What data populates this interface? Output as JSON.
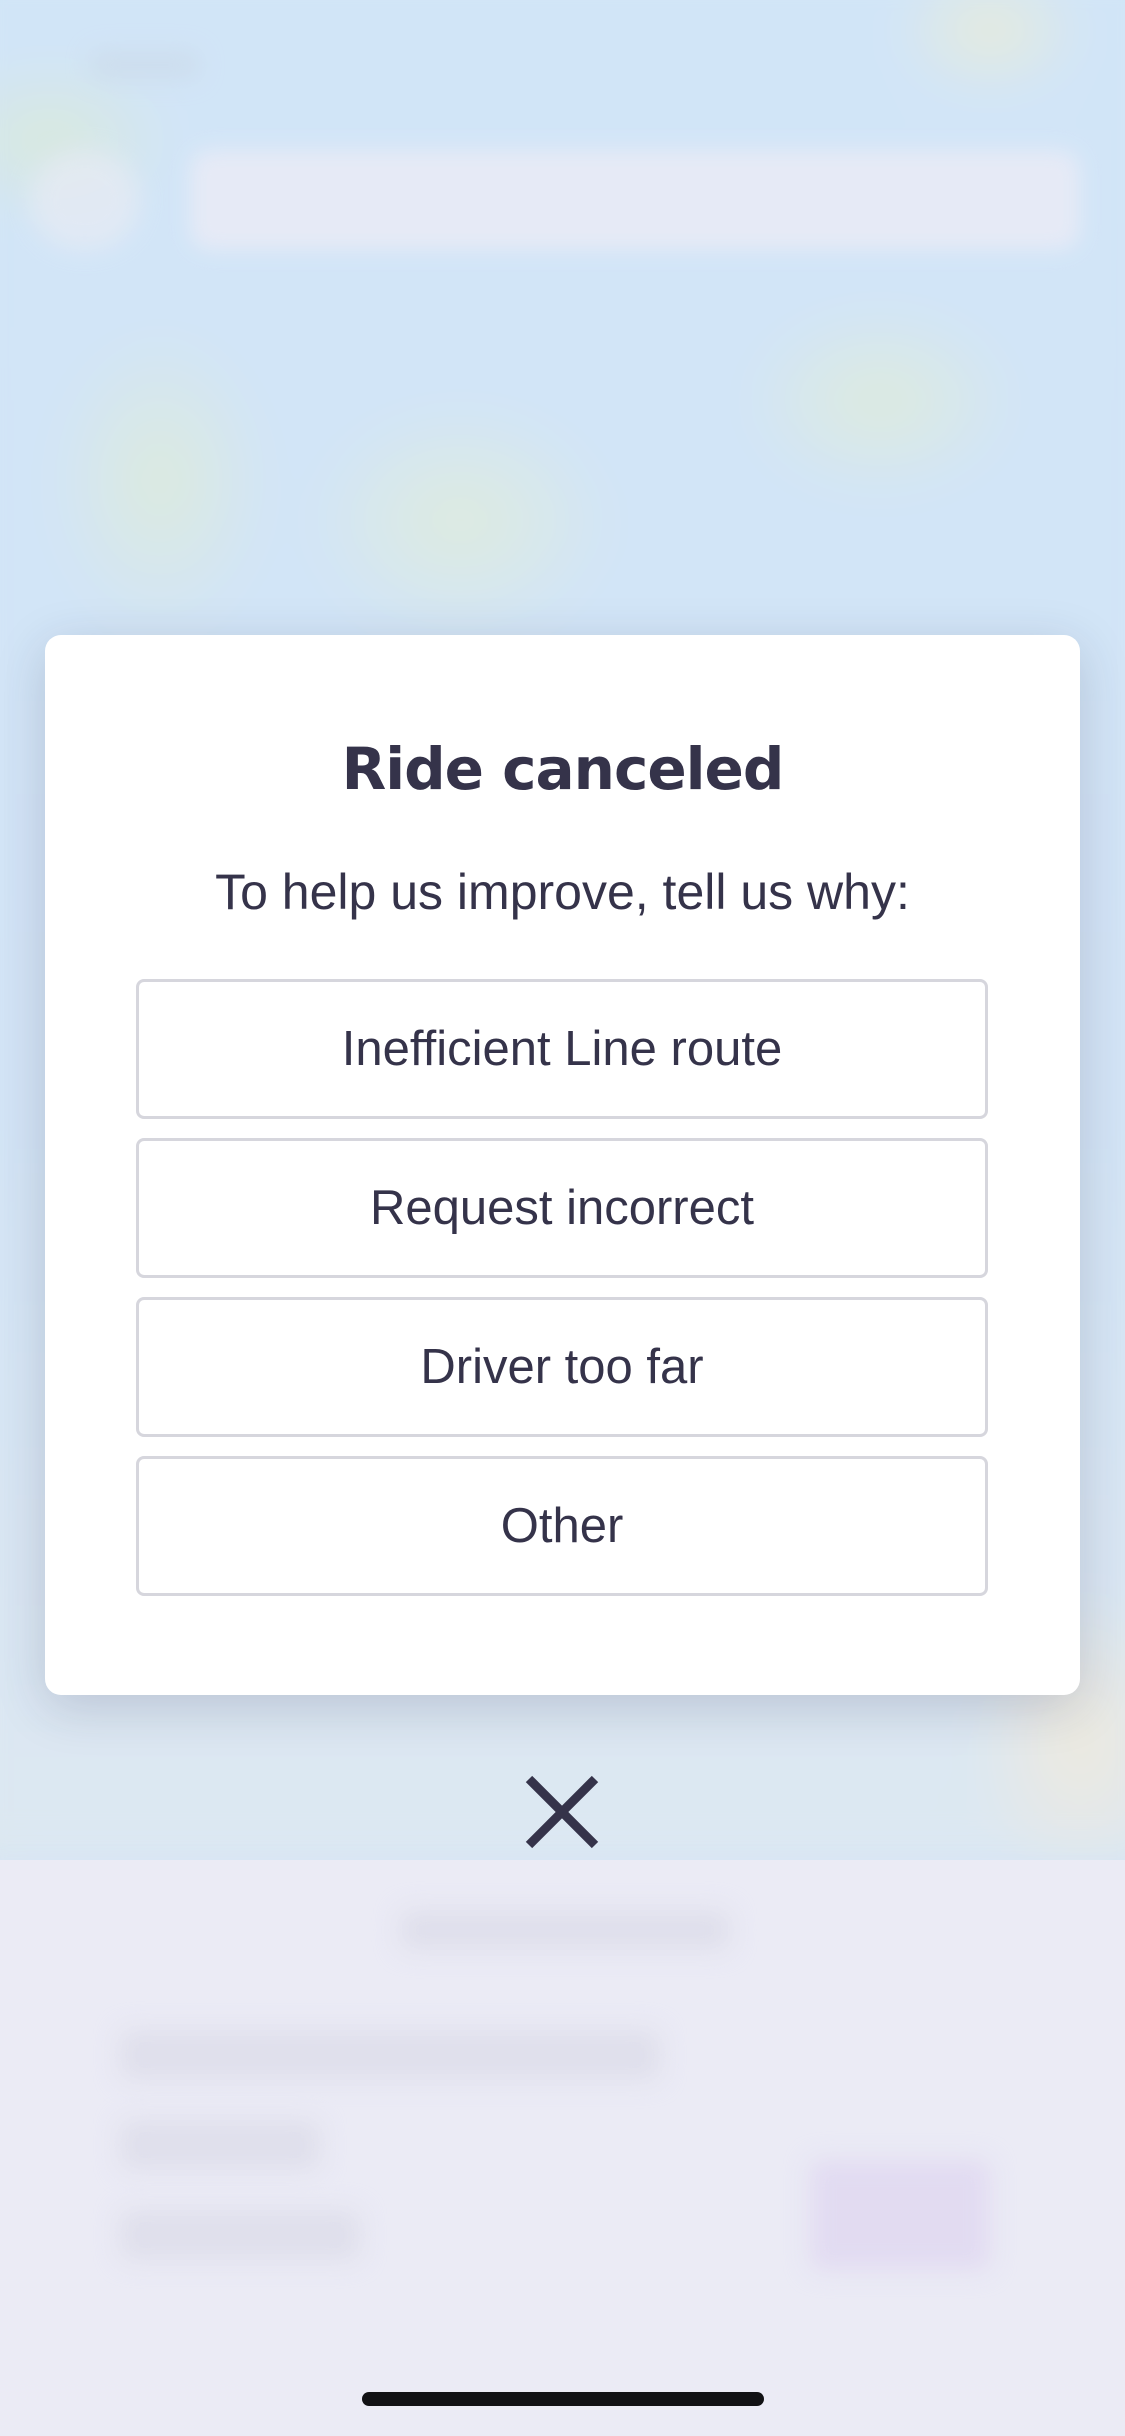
{
  "modal": {
    "title": "Ride canceled",
    "subtitle": "To help us improve, tell us why:",
    "options": [
      {
        "label": "Inefficient Line route"
      },
      {
        "label": "Request incorrect"
      },
      {
        "label": "Driver too far"
      },
      {
        "label": "Other"
      }
    ]
  },
  "icons": {
    "close": "close-icon"
  },
  "colors": {
    "text_primary": "#35334a",
    "option_border": "#d6d6dd",
    "modal_background": "#ffffff",
    "map_water": "#c4e2f8"
  }
}
